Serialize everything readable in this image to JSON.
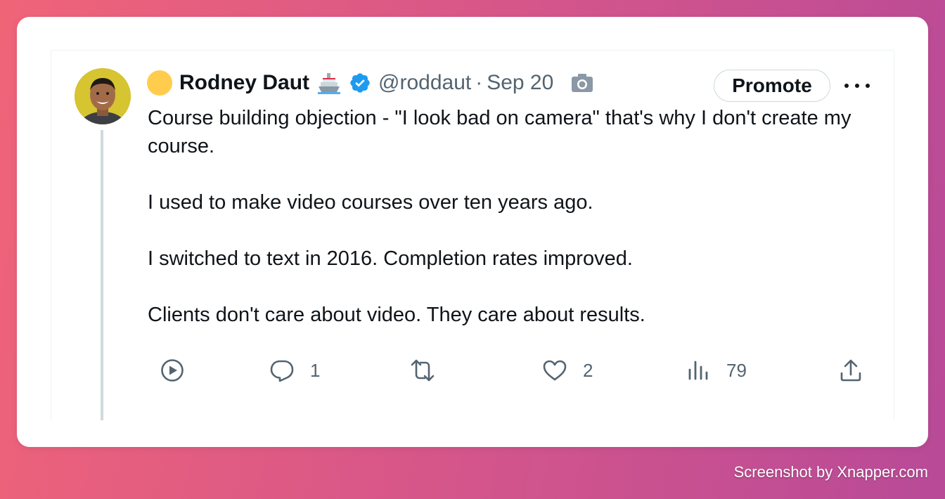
{
  "tweet": {
    "author_name": "Rodney Daut",
    "handle": "@roddaut",
    "separator": "·",
    "date": "Sep 20",
    "promote_label": "Promote",
    "body": [
      "Course building objection - \"I look bad on camera\" that's why I don't create my course.",
      "I used to make video courses over ten years ago.",
      "I switched to text in 2016. Completion rates improved.",
      "Clients don't care about video. They care about results."
    ],
    "actions": {
      "play": {
        "icon": "play-circle-icon"
      },
      "reply": {
        "icon": "reply-icon",
        "count": "1"
      },
      "retweet": {
        "icon": "retweet-icon"
      },
      "like": {
        "icon": "heart-icon",
        "count": "2"
      },
      "views": {
        "icon": "views-icon",
        "count": "79"
      },
      "share": {
        "icon": "share-icon"
      }
    }
  },
  "watermark": "Screenshot by Xnapper.com",
  "colors": {
    "verified": "#1d9bf0",
    "secondary_text": "#536471",
    "status_dot": "#ffcc4d"
  }
}
